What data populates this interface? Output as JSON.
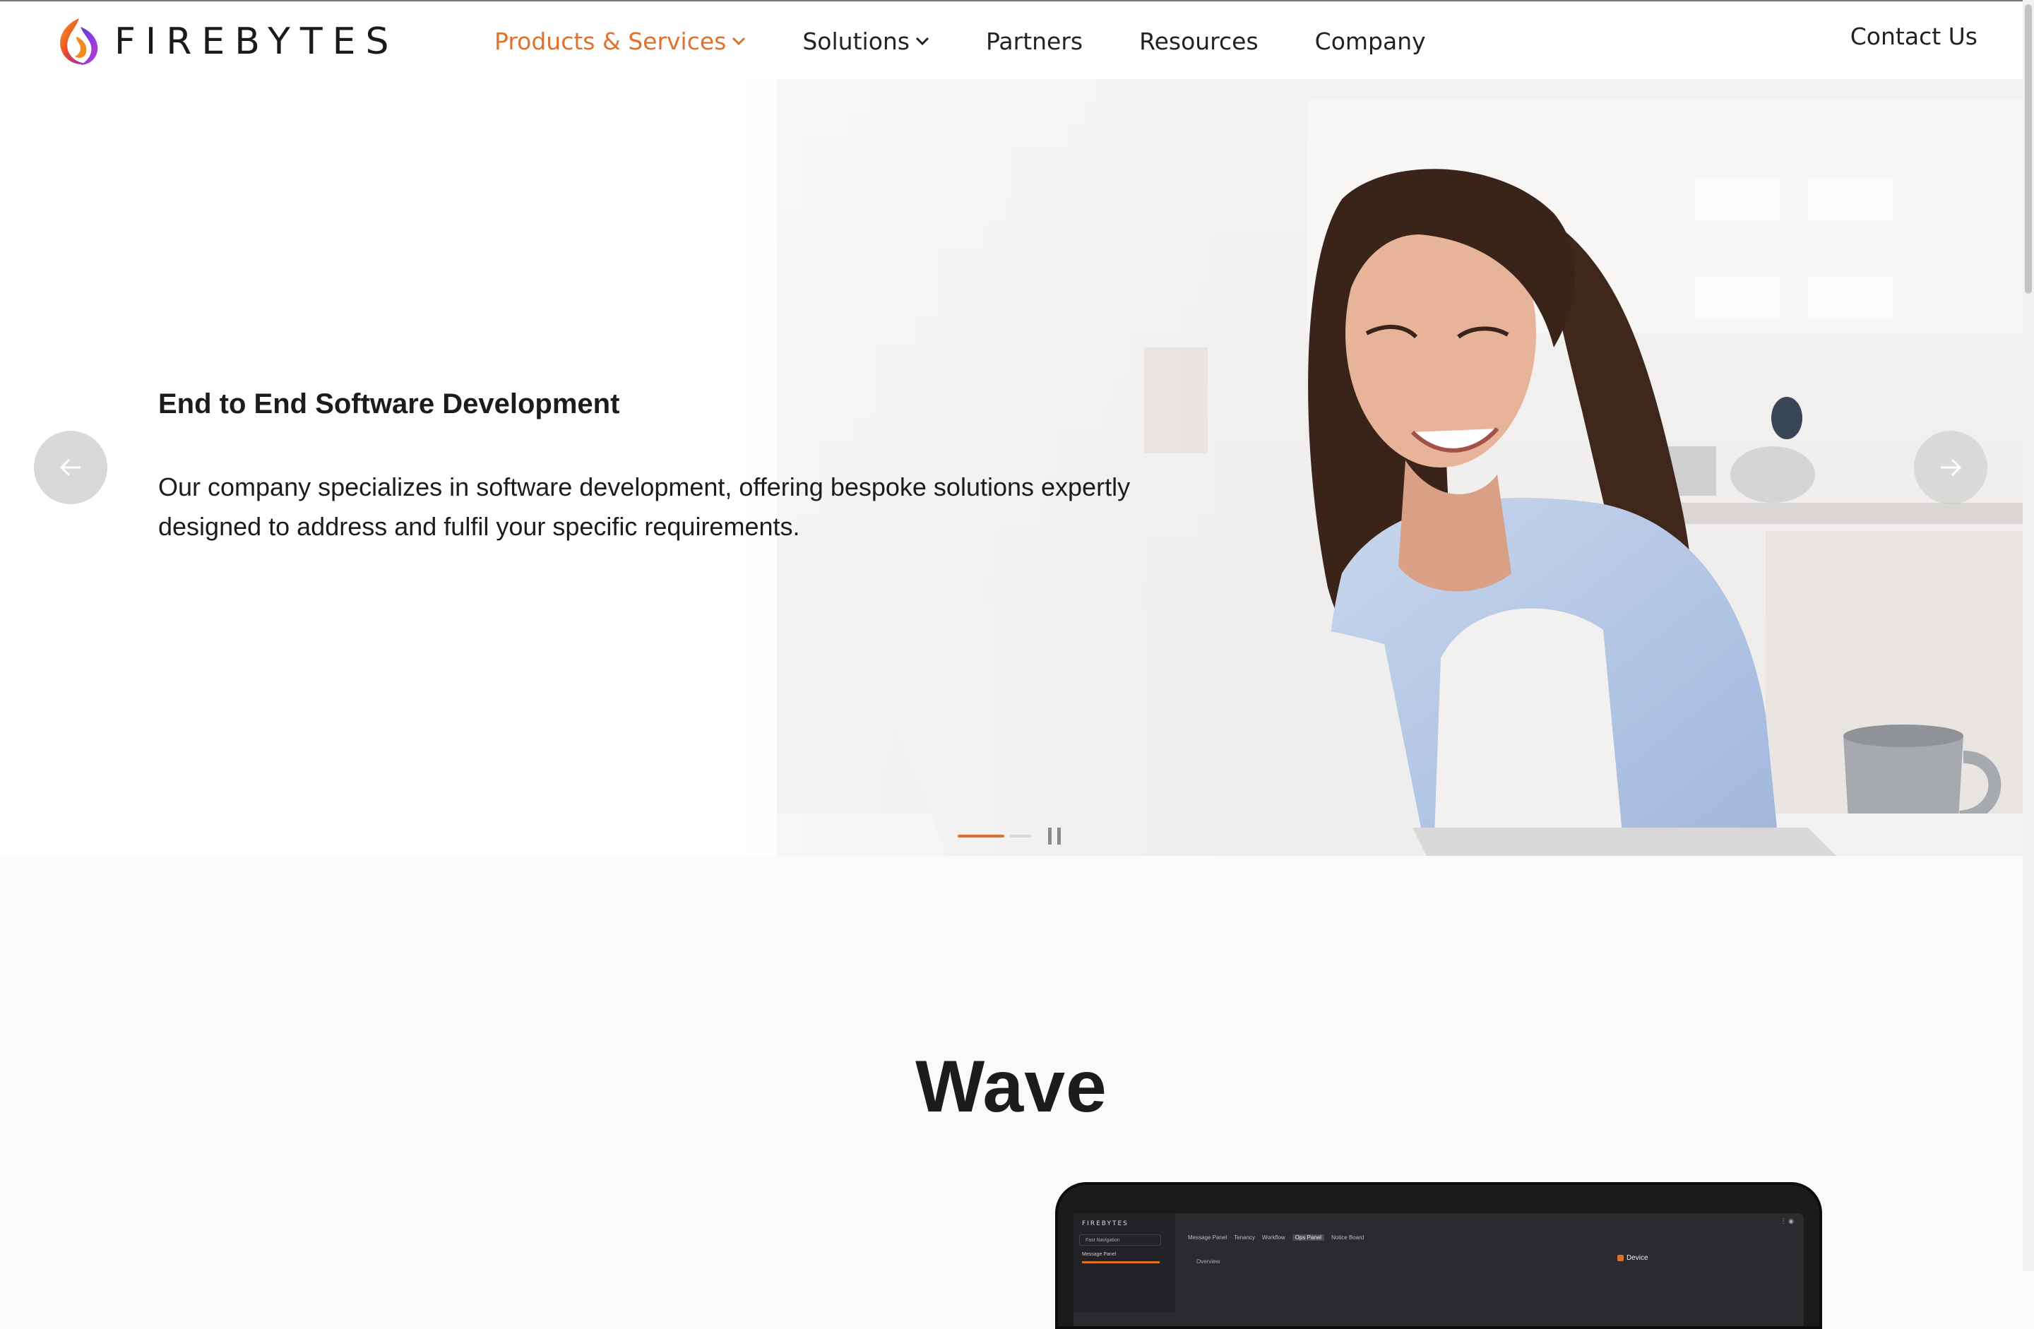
{
  "brand": {
    "name": "FIREBYTES",
    "accent": "#e0712d"
  },
  "nav": {
    "items": [
      {
        "label": "Products & Services",
        "has_dropdown": true,
        "active": true
      },
      {
        "label": "Solutions",
        "has_dropdown": true,
        "active": false
      },
      {
        "label": "Partners",
        "has_dropdown": false,
        "active": false
      },
      {
        "label": "Resources",
        "has_dropdown": false,
        "active": false
      },
      {
        "label": "Company",
        "has_dropdown": false,
        "active": false
      }
    ],
    "contact": "Contact Us"
  },
  "hero": {
    "title": "End to End Software Development",
    "text": "Our company specializes in software development, offering bespoke solutions expertly designed to address and fulfil your specific requirements.",
    "slide_index": 1,
    "slide_count": 2,
    "prev_icon": "arrow-left-icon",
    "next_icon": "arrow-right-icon",
    "pause_icon": "pause-icon"
  },
  "wave": {
    "title": "Wave",
    "screen": {
      "brand": "FIREBYTES",
      "search_placeholder": "Fast Navigation",
      "menu_item": "Message Panel",
      "tabs": [
        {
          "label": "Message Panel",
          "selected": false
        },
        {
          "label": "Tenancy",
          "selected": false
        },
        {
          "label": "Workflow",
          "selected": false
        },
        {
          "label": "Ops Panel",
          "selected": true
        },
        {
          "label": "Notice Board",
          "selected": false
        }
      ],
      "overview": "Overview",
      "device_label": "Device"
    }
  }
}
